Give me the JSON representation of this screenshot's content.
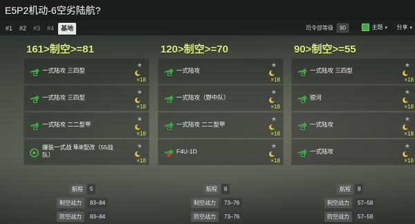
{
  "header": {
    "title": "E5P2机动-6空劣陆航?"
  },
  "tabs": [
    {
      "label": "#1",
      "state": "normal"
    },
    {
      "label": "#2",
      "state": "normal"
    },
    {
      "label": "#3",
      "state": "dim"
    },
    {
      "label": "#4",
      "state": "dim"
    },
    {
      "label": "基地",
      "state": "active"
    }
  ],
  "toolbar": {
    "hq_label": "司令部等级",
    "hq_level": "90",
    "theme_label": "主题",
    "share_label": "分享",
    "caret": "▾",
    "theme_color": "#3ea84a"
  },
  "columns": [
    {
      "title": "161>制空>=81",
      "slots": [
        {
          "name": "一式陆攻 三四型",
          "count": "×18",
          "icon": "land-attacker-icon"
        },
        {
          "name": "一式陆攻 三四型",
          "count": "×18",
          "icon": "land-attacker-icon"
        },
        {
          "name": "一式陆攻 二二型甲",
          "count": "×18",
          "icon": "land-attacker-icon"
        },
        {
          "name": "爆装一式战 隼Ⅲ型改（55战队）",
          "count": "×18",
          "icon": "fighter-bomber-icon",
          "two_line": true
        }
      ],
      "range_label": "航程",
      "range": "5",
      "air_label": "制空战力",
      "air": "83–84",
      "def_label": "防空战力",
      "def": "83–84"
    },
    {
      "title": "120>制空>=70",
      "slots": [
        {
          "name": "一式陆攻",
          "count": "×18",
          "icon": "land-attacker-icon"
        },
        {
          "name": "一式陆攻（野中队）",
          "count": "×18",
          "icon": "land-attacker-icon"
        },
        {
          "name": "一式陆攻 二二型甲",
          "count": "×18",
          "icon": "land-attacker-icon"
        },
        {
          "name": "F4U-1D",
          "count": "×18",
          "icon": "f4u-icon"
        }
      ],
      "range_label": "航程",
      "range": "6",
      "air_label": "制空战力",
      "air": "73–76",
      "def_label": "防空战力",
      "def": "73–76"
    },
    {
      "title": "90>制空>=55",
      "slots": [
        {
          "name": "一式陆攻 三四型",
          "count": "×18",
          "icon": "land-attacker-icon"
        },
        {
          "name": "银河",
          "count": "×18",
          "icon": "land-attacker-icon"
        },
        {
          "name": "一式陆攻",
          "count": "×18",
          "icon": "land-attacker-icon"
        },
        {
          "name": "一式陆攻",
          "count": "×18",
          "icon": "land-attacker-icon"
        }
      ],
      "range_label": "航程",
      "range": "8",
      "air_label": "制空战力",
      "air": "57–58",
      "def_label": "防空战力",
      "def": "57–58"
    }
  ],
  "colors": {
    "title_green": "#d6f07a",
    "count_yellow": "#d2e86e",
    "plane_green": "#3ea84a"
  }
}
